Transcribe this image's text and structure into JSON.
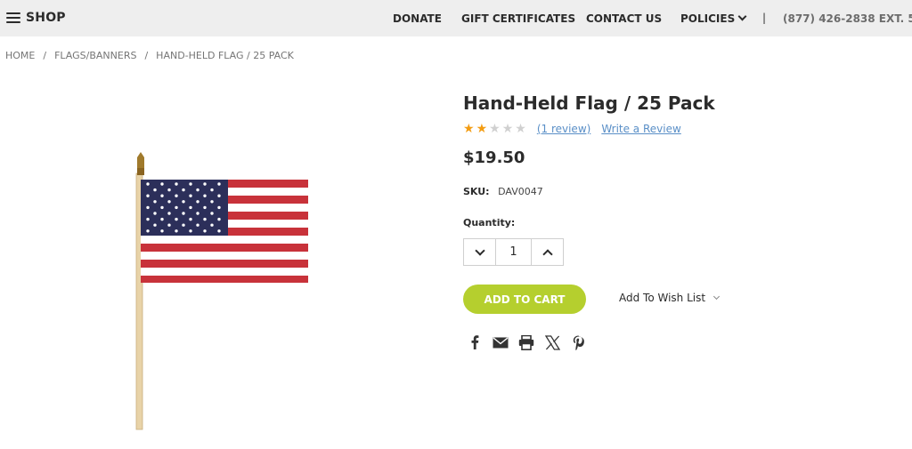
{
  "header": {
    "shop_label": "SHOP",
    "nav": {
      "donate": "DONATE",
      "gift": "GIFT CERTIFICATES",
      "contact": "CONTACT US",
      "policies": "POLICIES"
    },
    "separator": "|",
    "phone": "(877) 426-2838 EXT. 5"
  },
  "breadcrumb": {
    "items": [
      "HOME",
      "FLAGS/BANNERS",
      "HAND-HELD FLAG / 25 PACK"
    ],
    "separator": "/"
  },
  "product": {
    "title": "Hand-Held Flag / 25 Pack",
    "rating": 2,
    "rating_max": 5,
    "review_link": "(1 review)",
    "write_review": "Write a Review",
    "price": "$19.50",
    "sku_label": "SKU:",
    "sku_value": "DAV0047",
    "quantity_label": "Quantity:",
    "quantity_value": "1",
    "add_to_cart": "ADD TO CART",
    "wishlist": "Add To Wish List",
    "share_icons": [
      "facebook-icon",
      "email-icon",
      "print-icon",
      "x-icon",
      "pinterest-icon"
    ]
  },
  "colors": {
    "accent": "#b5cf2e",
    "star_filled": "#f39c12",
    "star_empty": "#d0d0d0",
    "link": "#5a8fc7",
    "topbar": "#eeeeee"
  }
}
